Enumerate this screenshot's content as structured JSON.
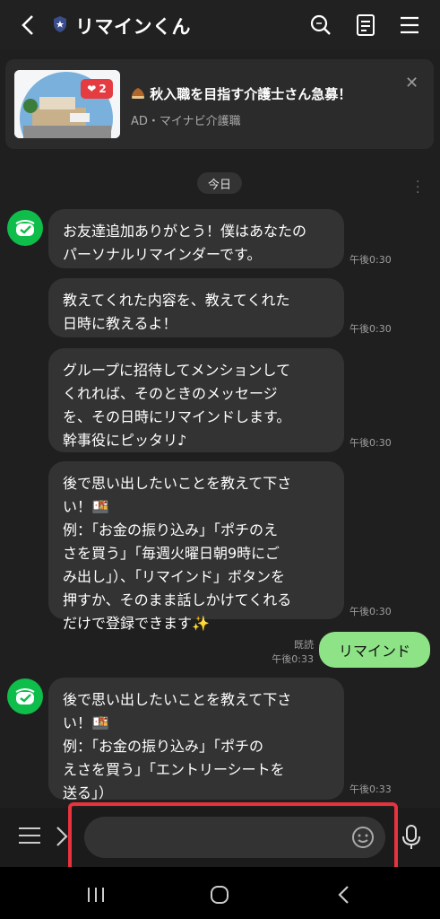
{
  "header": {
    "title": "リマインくん",
    "icons": [
      "back-arrow-icon",
      "shield-star-icon",
      "search-icon",
      "notes-icon",
      "menu-icon"
    ]
  },
  "ad": {
    "badge_count": "2",
    "title": "秋入職を目指す介護士さん急募！",
    "sponsor": "AD・マイナビ介護職"
  },
  "date_label": "今日",
  "messages": [
    {
      "text": "お友達追加ありがとう！僕はあなたの\nパーソナルリマインダーです。",
      "time": "午後0:30"
    },
    {
      "text": "教えてくれた内容を、教えてくれた\n日時に教えるよ！",
      "time": "午後0:30"
    },
    {
      "text": "グループに招待してメンションして\nくれれば、そのときのメッセージ\nを、その日時にリマインドします。\n幹事役にピッタリ♪",
      "time": "午後0:30"
    },
    {
      "text": "後で思い出したいことを教えて下さ\nい！🍱\n例：「お金の振り込み」「ポチのえ\nさを買う」「毎週火曜日朝9時にご\nみ出し」）、「リマインド」ボタンを\n押すか、そのまま話しかけてくれる\nだけで登録できます✨",
      "time": "午後0:30"
    },
    {
      "text": "後で思い出したいことを教えて下さ\nい！🍱\n 例：「お金の振り込み」「ポチの\nえさを買う」「エントリーシートを\n送る」）",
      "time": "午後0:33"
    }
  ],
  "my_message": {
    "text": "リマインド",
    "read": "既読",
    "time": "午後0:33"
  },
  "input": {
    "placeholder": ""
  },
  "colors": {
    "accent_green": "#8ee386",
    "avatar_green": "#0fbd4a",
    "highlight": "#e8323e"
  }
}
